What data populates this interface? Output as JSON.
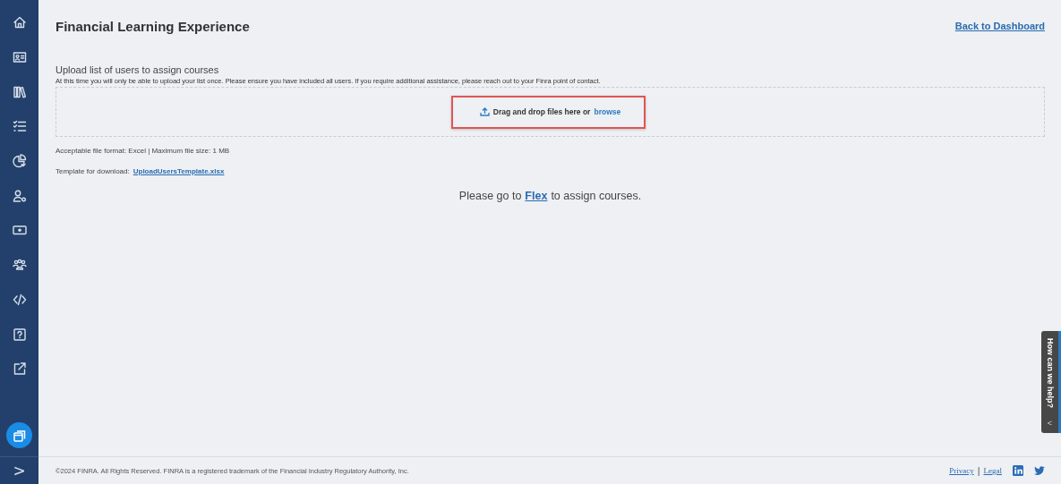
{
  "sidebar": {
    "items": [
      {
        "kind": "home"
      },
      {
        "kind": "id-card"
      },
      {
        "kind": "library"
      },
      {
        "kind": "checklist"
      },
      {
        "kind": "pie"
      },
      {
        "kind": "user-gear"
      },
      {
        "kind": "cash"
      },
      {
        "kind": "group"
      },
      {
        "kind": "code"
      },
      {
        "kind": "help"
      },
      {
        "kind": "external"
      }
    ],
    "action": {
      "kind": "windows"
    },
    "expand": {
      "label": ">"
    }
  },
  "header": {
    "title": "Financial Learning Experience",
    "back_link": "Back to Dashboard"
  },
  "upload": {
    "heading": "Upload list of users to assign courses",
    "note": "At this time you will only be able to upload your list once. Please ensure you have included all users. If you require additional assistance, please reach out to your Finra point of contact.",
    "dropzone": {
      "prompt": "Drag and drop files here or",
      "browse": "browse",
      "highlighted": true
    },
    "format_note": "Acceptable file format: Excel | Maximum file size: 1 MB",
    "template_label": "Template for download:",
    "template_link": "UploadUsersTemplate.xlsx"
  },
  "message": {
    "before": "Please go to",
    "link": "Flex",
    "after": "to assign courses."
  },
  "help_tab": {
    "label": "How can we help?",
    "chevron": "<"
  },
  "footer": {
    "copyright": "©2024 FINRA. All Rights Reserved. FINRA is a registered trademark of the Financial Industry Regulatory Authority, Inc.",
    "links": [
      "Privacy",
      "Legal"
    ],
    "separator": "|",
    "social": [
      {
        "kind": "linkedin"
      },
      {
        "kind": "twitter"
      }
    ]
  }
}
